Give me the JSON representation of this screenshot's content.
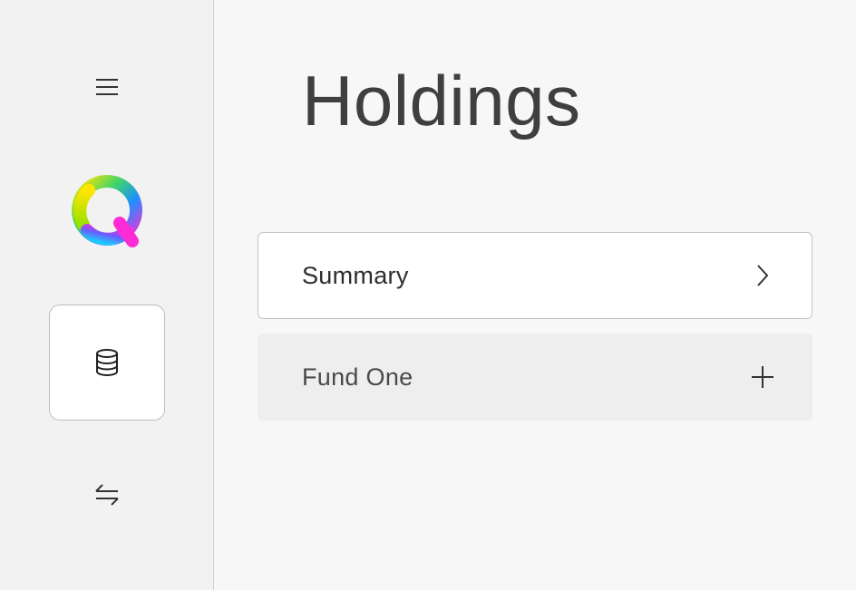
{
  "sidebar": {
    "menu_icon": "hamburger-menu-icon",
    "logo_icon": "q-logo",
    "nav": [
      {
        "id": "holdings",
        "icon": "database-icon",
        "active": true
      },
      {
        "id": "transfer",
        "icon": "transfer-arrows-icon",
        "active": false
      }
    ]
  },
  "main": {
    "title": "Holdings",
    "rows": [
      {
        "label": "Summary",
        "icon": "chevron-right-icon"
      },
      {
        "label": "Fund One",
        "icon": "plus-icon"
      }
    ]
  },
  "colors": {
    "background": "#f7f7f7",
    "sidebar": "#f2f2f2",
    "text": "#3f3f3f",
    "logo_gradient": [
      "#f5e600",
      "#2ecc71",
      "#1e90ff",
      "#ff2bd6"
    ]
  }
}
